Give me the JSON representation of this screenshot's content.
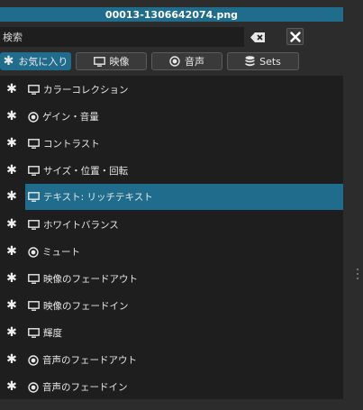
{
  "window": {
    "title": "00013-1306642074.png"
  },
  "search": {
    "placeholder": "検索",
    "value": ""
  },
  "tabs": [
    {
      "label": "お気に入り",
      "icon": "star-icon",
      "active": true
    },
    {
      "label": "映像",
      "icon": "monitor-icon",
      "active": false
    },
    {
      "label": "音声",
      "icon": "audio-disc-icon",
      "active": false
    },
    {
      "label": "Sets",
      "icon": "database-icon",
      "active": false
    }
  ],
  "filters": [
    {
      "label": "カラーコレクション",
      "type": "video",
      "icon": "monitor-icon",
      "selected": false
    },
    {
      "label": "ゲイン・音量",
      "type": "audio",
      "icon": "audio-disc-icon",
      "selected": false
    },
    {
      "label": "コントラスト",
      "type": "video",
      "icon": "monitor-icon",
      "selected": false
    },
    {
      "label": "サイズ・位置・回転",
      "type": "video",
      "icon": "monitor-icon",
      "selected": false
    },
    {
      "label": "テキスト: リッチテキスト",
      "type": "video",
      "icon": "monitor-icon",
      "selected": true
    },
    {
      "label": "ホワイトバランス",
      "type": "video",
      "icon": "monitor-icon",
      "selected": false
    },
    {
      "label": "ミュート",
      "type": "audio",
      "icon": "audio-disc-icon",
      "selected": false
    },
    {
      "label": "映像のフェードアウト",
      "type": "video",
      "icon": "monitor-icon",
      "selected": false
    },
    {
      "label": "映像のフェードイン",
      "type": "video",
      "icon": "monitor-icon",
      "selected": false
    },
    {
      "label": "輝度",
      "type": "video",
      "icon": "monitor-icon",
      "selected": false
    },
    {
      "label": "音声のフェードアウト",
      "type": "audio",
      "icon": "audio-disc-icon",
      "selected": false
    },
    {
      "label": "音声のフェードイン",
      "type": "audio",
      "icon": "audio-disc-icon",
      "selected": false
    }
  ],
  "colors": {
    "accent": "#1f6c8c",
    "panel": "#2c2c2c",
    "list_bg": "#1e1e1e"
  }
}
